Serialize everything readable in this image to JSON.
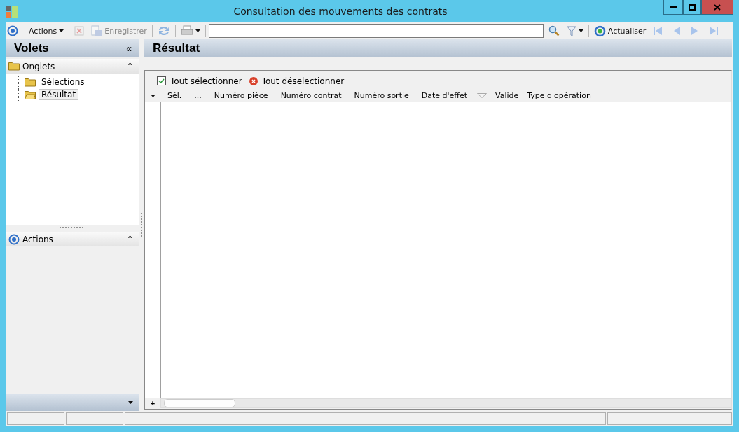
{
  "window": {
    "title": "Consultation des mouvements des contrats"
  },
  "toolbar": {
    "actions_menu": "Actions",
    "delete": {
      "disabled": true
    },
    "save": {
      "label": "Enregistrer",
      "disabled": true
    },
    "refresh": "Actualiser"
  },
  "sidebar": {
    "title": "Volets",
    "collapse": "«",
    "sections": [
      {
        "kind": "tree",
        "title": "Onglets",
        "expand": "⌃",
        "items": [
          {
            "label": "Sélections",
            "selected": false
          },
          {
            "label": "Résultat",
            "selected": true
          }
        ]
      },
      {
        "kind": "actions",
        "title": "Actions",
        "expand": "⌃"
      }
    ]
  },
  "content": {
    "title": "Résultat",
    "grid_toolbar": {
      "select_all": "Tout sélectionner",
      "deselect_all": "Tout déselectionner"
    },
    "columns": [
      {
        "label": "Sél."
      },
      {
        "label": "..."
      },
      {
        "label": "Numéro pièce"
      },
      {
        "label": "Numéro contrat"
      },
      {
        "label": "Numéro sortie"
      },
      {
        "label": "Date d'effet",
        "filter": true
      },
      {
        "label": "Valide"
      },
      {
        "label": "Type d'opération"
      }
    ],
    "add_row": "+"
  }
}
